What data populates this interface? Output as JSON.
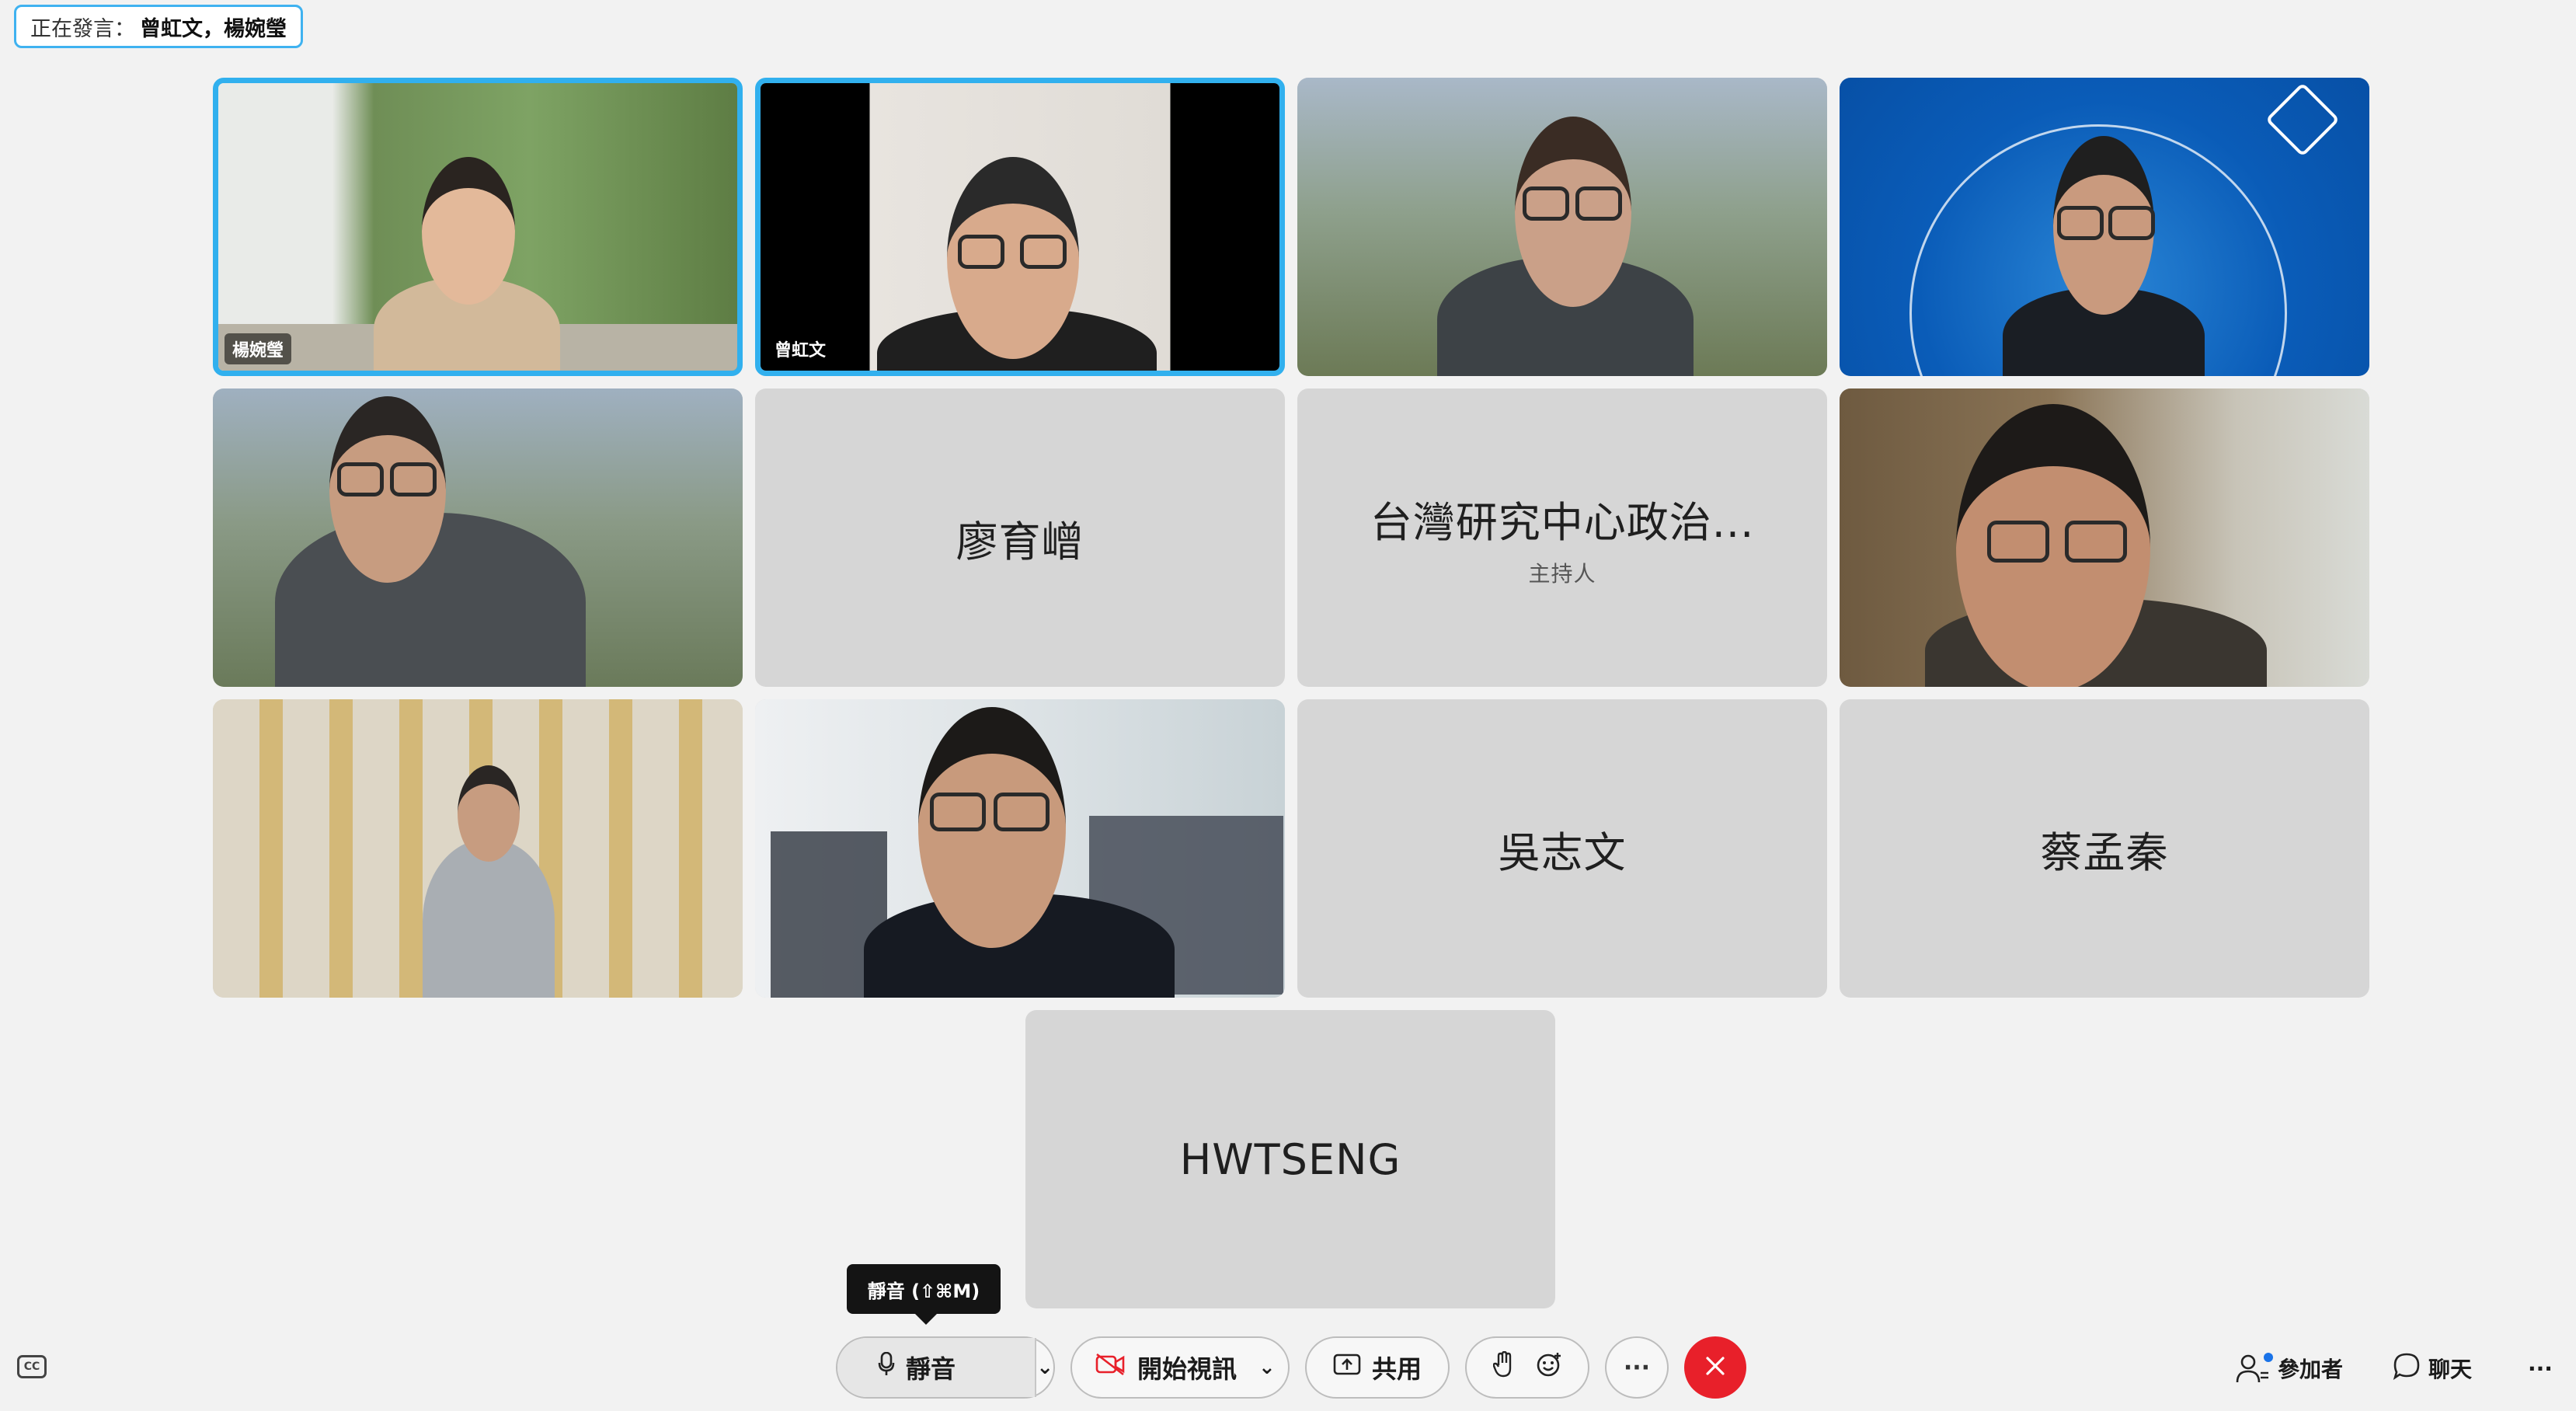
{
  "speaking": {
    "label": "正在發言：",
    "names": "曾虹文，楊婉瑩"
  },
  "tiles": [
    {
      "name": "楊婉瑩",
      "type": "video",
      "active": true
    },
    {
      "name": "曾虹文",
      "type": "video",
      "active": true
    },
    {
      "name": "",
      "type": "video"
    },
    {
      "name": "",
      "type": "video"
    },
    {
      "name": "",
      "type": "video"
    },
    {
      "name": "廖育嶒",
      "type": "avatar"
    },
    {
      "name": "台灣研究中心政治...",
      "subtitle": "主持人",
      "type": "avatar"
    },
    {
      "name": "",
      "type": "video"
    },
    {
      "name": "",
      "type": "video"
    },
    {
      "name": "",
      "type": "video"
    },
    {
      "name": "吳志文",
      "type": "avatar"
    },
    {
      "name": "蔡孟秦",
      "type": "avatar"
    },
    {
      "name": "HWTSENG",
      "type": "avatar"
    }
  ],
  "toolbar": {
    "cc_label": "CC",
    "mute_label": "靜音",
    "mute_tooltip": "靜音 (⇧⌘M)",
    "video_label": "開始視訊",
    "share_label": "共用",
    "more_label": "···",
    "participants_label": "參加者",
    "chat_label": "聊天",
    "overflow_label": "···"
  },
  "colors": {
    "active_border": "#31b0ee",
    "leave": "#e8202a",
    "tile_bg": "#d6d6d6"
  }
}
